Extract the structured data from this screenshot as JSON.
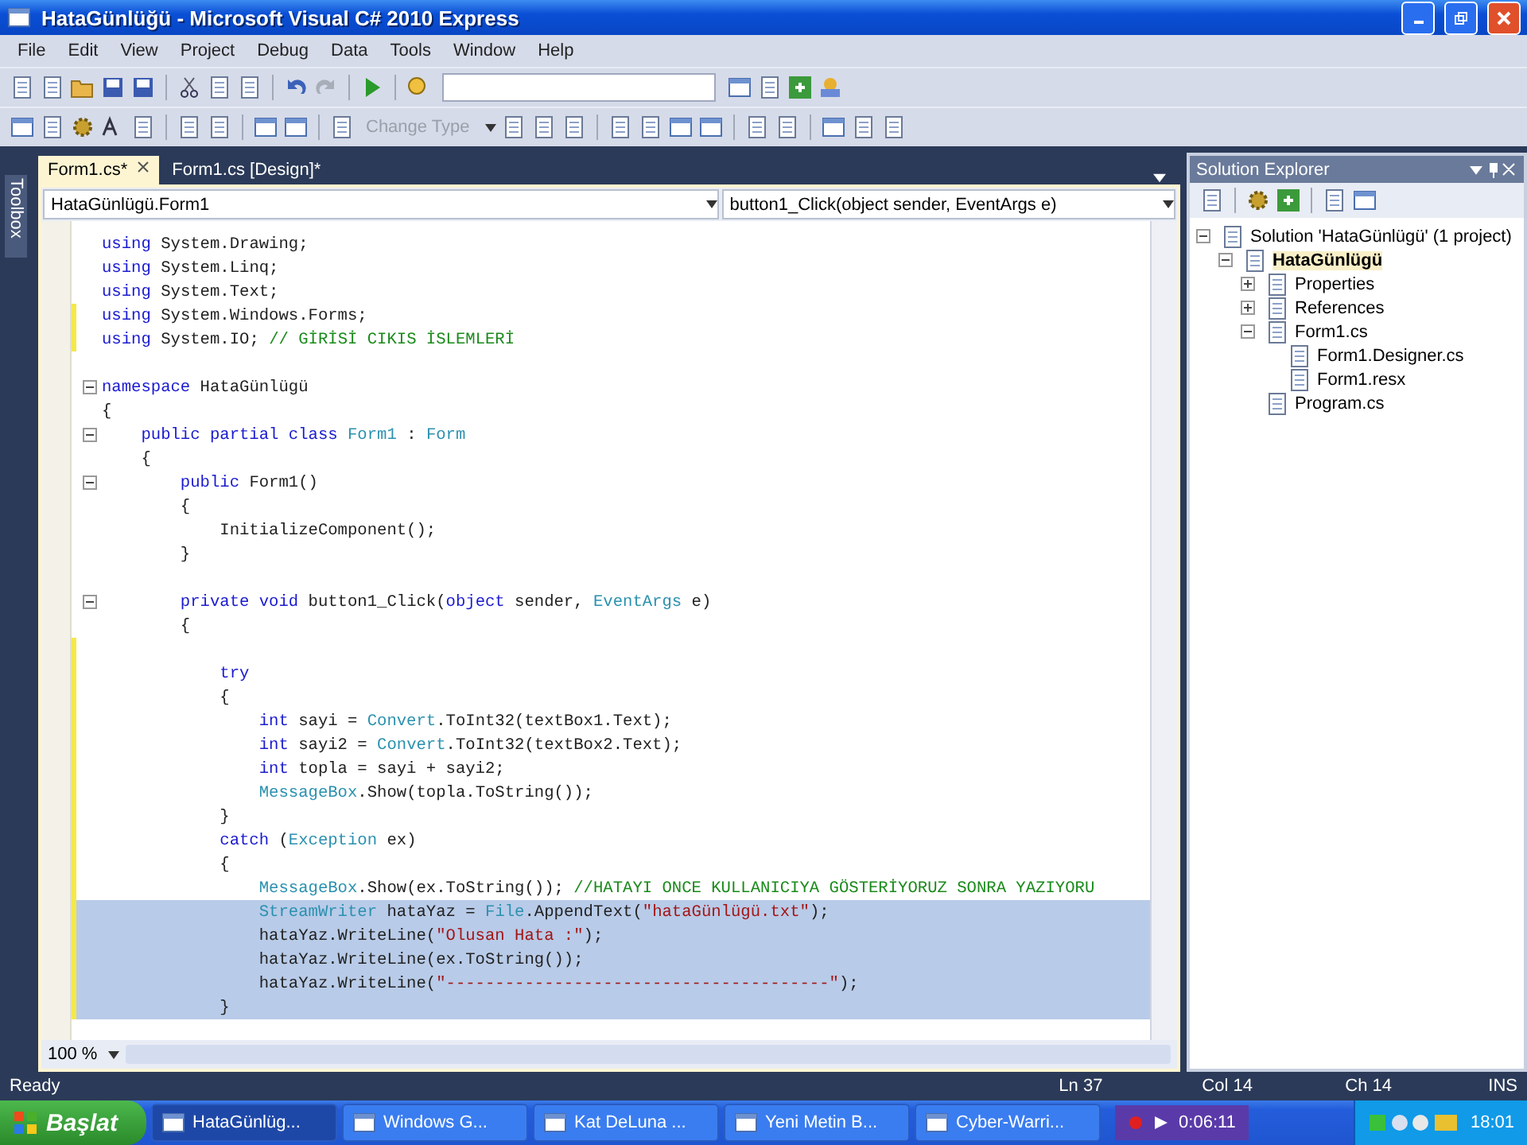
{
  "window": {
    "title": "HataGünlüğü - Microsoft Visual C# 2010 Express"
  },
  "menu": [
    "File",
    "Edit",
    "View",
    "Project",
    "Debug",
    "Data",
    "Tools",
    "Window",
    "Help"
  ],
  "toolbar2": {
    "change_type": {
      "label": "Change Type",
      "disabled": true
    }
  },
  "toolbox": {
    "label": "Toolbox"
  },
  "doc_tabs": [
    {
      "label": "Form1.cs*",
      "selected": true
    },
    {
      "label": "Form1.cs [Design]*",
      "selected": false
    }
  ],
  "nav_bar": {
    "type_combo": "HataGünlügü.Form1",
    "member_combo": "button1_Click(object sender, EventArgs e)"
  },
  "code_lines": [
    {
      "tokens": [
        {
          "kind": "kw",
          "text": "using"
        },
        {
          "kind": "plain",
          "text": " System.Drawing;"
        }
      ],
      "selected": false,
      "fold": false,
      "changed": false
    },
    {
      "tokens": [
        {
          "kind": "kw",
          "text": "using"
        },
        {
          "kind": "plain",
          "text": " System.Linq;"
        }
      ],
      "selected": false,
      "fold": false,
      "changed": false
    },
    {
      "tokens": [
        {
          "kind": "kw",
          "text": "using"
        },
        {
          "kind": "plain",
          "text": " System.Text;"
        }
      ],
      "selected": false,
      "fold": false,
      "changed": false
    },
    {
      "tokens": [
        {
          "kind": "kw",
          "text": "using"
        },
        {
          "kind": "plain",
          "text": " System.Windows.Forms;"
        }
      ],
      "selected": false,
      "fold": false,
      "changed": true
    },
    {
      "tokens": [
        {
          "kind": "kw",
          "text": "using"
        },
        {
          "kind": "plain",
          "text": " System.IO; "
        },
        {
          "kind": "comment",
          "text": "// GİRİSİ CIKIS İSLEMLERİ"
        }
      ],
      "selected": false,
      "fold": false,
      "changed": true
    },
    {
      "selected": false,
      "fold": false,
      "changed": false
    },
    {
      "tokens": [
        {
          "kind": "kw",
          "text": "namespace"
        },
        {
          "kind": "plain",
          "text": " HataGünlügü"
        }
      ],
      "selected": false,
      "fold": true,
      "changed": false
    },
    {
      "tokens": [
        {
          "kind": "plain",
          "text": "{"
        }
      ],
      "selected": false,
      "fold": false,
      "changed": false
    },
    {
      "tokens": [
        {
          "kind": "kw",
          "text": "    public partial class "
        },
        {
          "kind": "type",
          "text": "Form1"
        },
        {
          "kind": "plain",
          "text": " : "
        },
        {
          "kind": "type",
          "text": "Form"
        }
      ],
      "selected": false,
      "fold": true,
      "changed": false
    },
    {
      "tokens": [
        {
          "kind": "plain",
          "text": "    {"
        }
      ],
      "selected": false,
      "fold": false,
      "changed": false
    },
    {
      "tokens": [
        {
          "kind": "kw",
          "text": "        public"
        },
        {
          "kind": "plain",
          "text": " Form1()"
        }
      ],
      "selected": false,
      "fold": true,
      "changed": false
    },
    {
      "tokens": [
        {
          "kind": "plain",
          "text": "        {"
        }
      ],
      "selected": false,
      "fold": false,
      "changed": false
    },
    {
      "tokens": [
        {
          "kind": "plain",
          "text": "            InitializeComponent();"
        }
      ],
      "selected": false,
      "fold": false,
      "changed": false
    },
    {
      "tokens": [
        {
          "kind": "plain",
          "text": "        }"
        }
      ],
      "selected": false,
      "fold": false,
      "changed": false
    },
    {
      "selected": false,
      "fold": false,
      "changed": false
    },
    {
      "tokens": [
        {
          "kind": "kw",
          "text": "        private void"
        },
        {
          "kind": "plain",
          "text": " button1_Click("
        },
        {
          "kind": "kw",
          "text": "object"
        },
        {
          "kind": "plain",
          "text": " sender, "
        },
        {
          "kind": "type",
          "text": "EventArgs"
        },
        {
          "kind": "plain",
          "text": " e)"
        }
      ],
      "selected": false,
      "fold": true,
      "changed": false
    },
    {
      "tokens": [
        {
          "kind": "plain",
          "text": "        {"
        }
      ],
      "selected": false,
      "fold": false,
      "changed": false
    },
    {
      "selected": false,
      "fold": false,
      "changed": true
    },
    {
      "tokens": [
        {
          "kind": "kw",
          "text": "            try"
        }
      ],
      "selected": false,
      "fold": false,
      "changed": true
    },
    {
      "tokens": [
        {
          "kind": "plain",
          "text": "            {"
        }
      ],
      "selected": false,
      "fold": false,
      "changed": true
    },
    {
      "tokens": [
        {
          "kind": "kw",
          "text": "                int"
        },
        {
          "kind": "plain",
          "text": " sayi = "
        },
        {
          "kind": "type",
          "text": "Convert"
        },
        {
          "kind": "plain",
          "text": ".ToInt32(textBox1.Text);"
        }
      ],
      "selected": false,
      "fold": false,
      "changed": true
    },
    {
      "tokens": [
        {
          "kind": "kw",
          "text": "                int"
        },
        {
          "kind": "plain",
          "text": " sayi2 = "
        },
        {
          "kind": "type",
          "text": "Convert"
        },
        {
          "kind": "plain",
          "text": ".ToInt32(textBox2.Text);"
        }
      ],
      "selected": false,
      "fold": false,
      "changed": true
    },
    {
      "tokens": [
        {
          "kind": "kw",
          "text": "                int"
        },
        {
          "kind": "plain",
          "text": " topla = sayi + sayi2;"
        }
      ],
      "selected": false,
      "fold": false,
      "changed": true
    },
    {
      "tokens": [
        {
          "kind": "type",
          "text": "                MessageBox"
        },
        {
          "kind": "plain",
          "text": ".Show(topla.ToString());"
        }
      ],
      "selected": false,
      "fold": false,
      "changed": true
    },
    {
      "tokens": [
        {
          "kind": "plain",
          "text": "            }"
        }
      ],
      "selected": false,
      "fold": false,
      "changed": true
    },
    {
      "tokens": [
        {
          "kind": "kw",
          "text": "            catch"
        },
        {
          "kind": "plain",
          "text": " ("
        },
        {
          "kind": "type",
          "text": "Exception"
        },
        {
          "kind": "plain",
          "text": " ex)"
        }
      ],
      "selected": false,
      "fold": false,
      "changed": true
    },
    {
      "tokens": [
        {
          "kind": "plain",
          "text": "            {"
        }
      ],
      "selected": false,
      "fold": false,
      "changed": true
    },
    {
      "tokens": [
        {
          "kind": "type",
          "text": "                MessageBox"
        },
        {
          "kind": "plain",
          "text": ".Show(ex.ToString()); "
        },
        {
          "kind": "comment",
          "text": "//HATAYI ONCE KULLANICIYA GÖSTERİYORUZ SONRA YAZIYORU"
        }
      ],
      "selected": false,
      "fold": false,
      "changed": true
    },
    {
      "tokens": [
        {
          "kind": "type",
          "text": "                StreamWriter"
        },
        {
          "kind": "plain",
          "text": " hataYaz = "
        },
        {
          "kind": "type",
          "text": "File"
        },
        {
          "kind": "plain",
          "text": ".AppendText("
        },
        {
          "kind": "string",
          "text": "\"hataGünlügü.txt\""
        },
        {
          "kind": "plain",
          "text": ");"
        }
      ],
      "selected": true,
      "fold": false,
      "changed": true
    },
    {
      "tokens": [
        {
          "kind": "plain",
          "text": "                hataYaz.WriteLine("
        },
        {
          "kind": "string",
          "text": "\"Olusan Hata :\""
        },
        {
          "kind": "plain",
          "text": ");"
        }
      ],
      "selected": true,
      "fold": false,
      "changed": true
    },
    {
      "tokens": [
        {
          "kind": "plain",
          "text": "                hataYaz.WriteLine(ex.ToString());"
        }
      ],
      "selected": true,
      "fold": false,
      "changed": true
    },
    {
      "tokens": [
        {
          "kind": "plain",
          "text": "                hataYaz.WriteLine("
        },
        {
          "kind": "string",
          "text": "\"---------------------------------------\""
        },
        {
          "kind": "plain",
          "text": ");"
        }
      ],
      "selected": true,
      "fold": false,
      "changed": true
    },
    {
      "tokens": [
        {
          "kind": "plain",
          "text": "            }"
        }
      ],
      "selected": true,
      "fold": false,
      "changed": true
    }
  ],
  "zoom": "100 %",
  "solution_explorer": {
    "title": "Solution Explorer",
    "tree": [
      {
        "label": "Solution 'HataGünlügü' (1 project)",
        "expanded": true,
        "bold": false,
        "children": [
          {
            "label": "HataGünlügü",
            "expanded": true,
            "bold": true,
            "children": [
              {
                "label": "Properties",
                "expanded": false,
                "bold": false
              },
              {
                "label": "References",
                "expanded": false,
                "bold": false
              },
              {
                "label": "Form1.cs",
                "expanded": true,
                "bold": false,
                "children": [
                  {
                    "label": "Form1.Designer.cs",
                    "bold": false
                  },
                  {
                    "label": "Form1.resx",
                    "bold": false
                  }
                ]
              },
              {
                "label": "Program.cs",
                "bold": false
              }
            ]
          }
        ]
      }
    ]
  },
  "status_bar": {
    "message": "Ready",
    "ln": "Ln 37",
    "col": "Col 14",
    "ch": "Ch 14",
    "mode": "INS"
  },
  "taskbar": {
    "start": "Başlat",
    "items": [
      {
        "label": "HataGünlüg...",
        "selected": true
      },
      {
        "label": "Windows G...",
        "selected": false
      },
      {
        "label": "Kat DeLuna ...",
        "selected": false
      },
      {
        "label": "Yeni Metin B...",
        "selected": false
      },
      {
        "label": "Cyber-Warri...",
        "selected": false
      }
    ],
    "recorder_time": "0:06:11",
    "clock": "18:01"
  }
}
